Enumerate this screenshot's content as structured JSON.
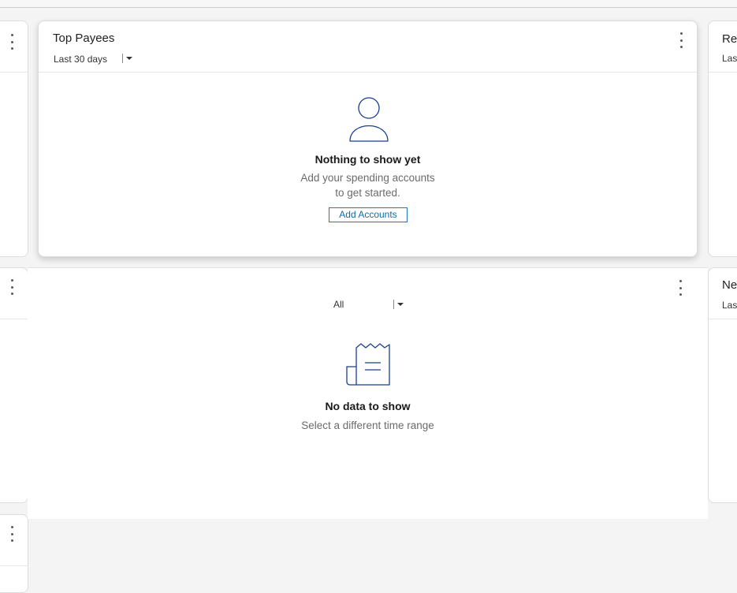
{
  "top_payees": {
    "title": "Top Payees",
    "period": "Last 30 days",
    "empty_title": "Nothing to show yet",
    "empty_sub_line1": "Add your spending accounts",
    "empty_sub_line2": "to get started.",
    "button": "Add Accounts"
  },
  "second_widget": {
    "period": "All",
    "empty_title": "No data to show",
    "empty_sub": "Select a different time range"
  },
  "right_cards": {
    "top_title_partial": "Rec",
    "top_sub_partial": "Last",
    "bottom_title_partial": "Ne",
    "bottom_sub_partial": "Last"
  },
  "icons": {
    "person": "person-icon",
    "receipt": "receipt-icon",
    "menu": "more-vertical-icon",
    "dropdown": "caret-down-icon"
  },
  "colors": {
    "accent": "#0d6ea8",
    "icon_stroke": "#1b3f8f"
  }
}
